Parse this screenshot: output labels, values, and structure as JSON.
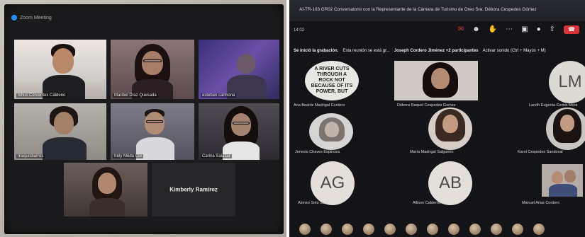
{
  "zoom": {
    "window_title": "Zoom Meeting",
    "participants": [
      {
        "name": "Ishus Cervantes Cáldeno",
        "active": true
      },
      {
        "name": "Maribel Díaz Quesada",
        "active": false
      },
      {
        "name": "esteban carmona",
        "active": false
      },
      {
        "name": "maquisbarres",
        "active": false
      },
      {
        "name": "Irely Mèda Cor",
        "active": false
      },
      {
        "name": "Carina Salazar",
        "active": false
      },
      {
        "name": "",
        "active": false
      },
      {
        "name": "Kimberly Ramírez",
        "active": false
      }
    ]
  },
  "teams": {
    "meeting_title": "AI-TR-103 GR02 Conversatorio con la Representante de la Cámara de Turismo de Oreo Sra. Débora Cespedes Gómez",
    "timer": "14:02",
    "notice": {
      "recording": "Se inició la grabación.",
      "recording_detail": "Esta reunión se está gr...",
      "presenter": "Joseph Cordero Jiménez +2 participantes",
      "audio_hint": "Activar sonido (Ctrl + Mayús + M)"
    },
    "quote_text": "A RIVER CUTS THROUGH A ROCK NOT BECAUSE OF ITS POWER, BUT",
    "tiles": [
      {
        "name": "Ana Beatriz Madrigal Cordero",
        "initials": ""
      },
      {
        "name": "Débora Raquel Cespedes Gomez",
        "initials": ""
      },
      {
        "name": "Landh Eugenia Corbix Mora",
        "initials": "LM"
      },
      {
        "name": "Jenesis Chaves Espinoza",
        "initials": ""
      },
      {
        "name": "María Madrigal Salgueiro",
        "initials": ""
      },
      {
        "name": "Karol Cespedes Sandoval",
        "initials": ""
      },
      {
        "name": "Alonso Soto Sanabria",
        "initials": "AG"
      },
      {
        "name": "Allison Calderón Benitez",
        "initials": "AB"
      },
      {
        "name": "Manuel Arias Cordero",
        "initials": ""
      }
    ],
    "icons": [
      "chat-icon",
      "people-icon",
      "raise-hand-icon",
      "more-icon",
      "camera-icon",
      "mic-icon",
      "share-icon",
      "hangup-icon"
    ],
    "colors": {
      "hangup": "#d9333a",
      "zoom_active_border": "#c6e05a",
      "zoom_blue": "#2d8cff"
    }
  }
}
